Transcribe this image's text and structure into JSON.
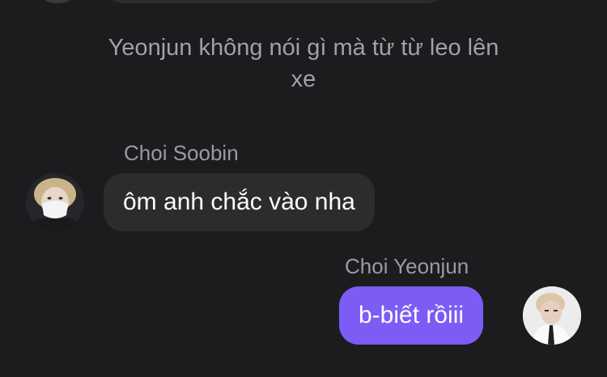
{
  "narration": {
    "text": "Yeonjun không nói gì mà từ từ leo lên xe"
  },
  "messages": [
    {
      "sender": "Choi Soobin",
      "text": "ôm anh chắc vào nha",
      "side": "left",
      "avatar_icon": "soobin-avatar"
    },
    {
      "sender": "Choi Yeonjun",
      "text": "b-biết rồiii",
      "side": "right",
      "avatar_icon": "yeonjun-avatar"
    }
  ],
  "colors": {
    "background": "#1c1c1e",
    "incoming_bubble": "#2c2c2e",
    "outgoing_bubble": "#7c5cf5",
    "sender_name": "#9a9aa0",
    "narration_text": "#a1a1a6"
  }
}
